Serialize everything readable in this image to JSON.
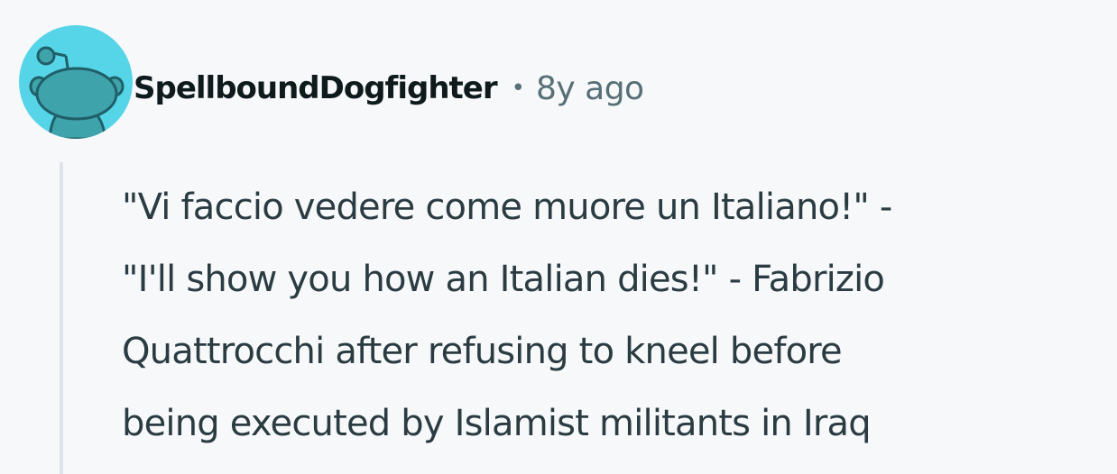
{
  "comment": {
    "author": "SpellboundDogfighter",
    "separator": "•",
    "timestamp": "8y ago",
    "avatar_icon": "snoo-avatar-icon",
    "avatar_color": "#57d5e8",
    "body_lines": [
      "\"Vi faccio vedere come muore un Italiano!\" -",
      "\"I'll show you how an Italian dies!\" - Fabrizio",
      "Quattrocchi after refusing to kneel before",
      "being executed by Islamist militants in Iraq"
    ]
  }
}
